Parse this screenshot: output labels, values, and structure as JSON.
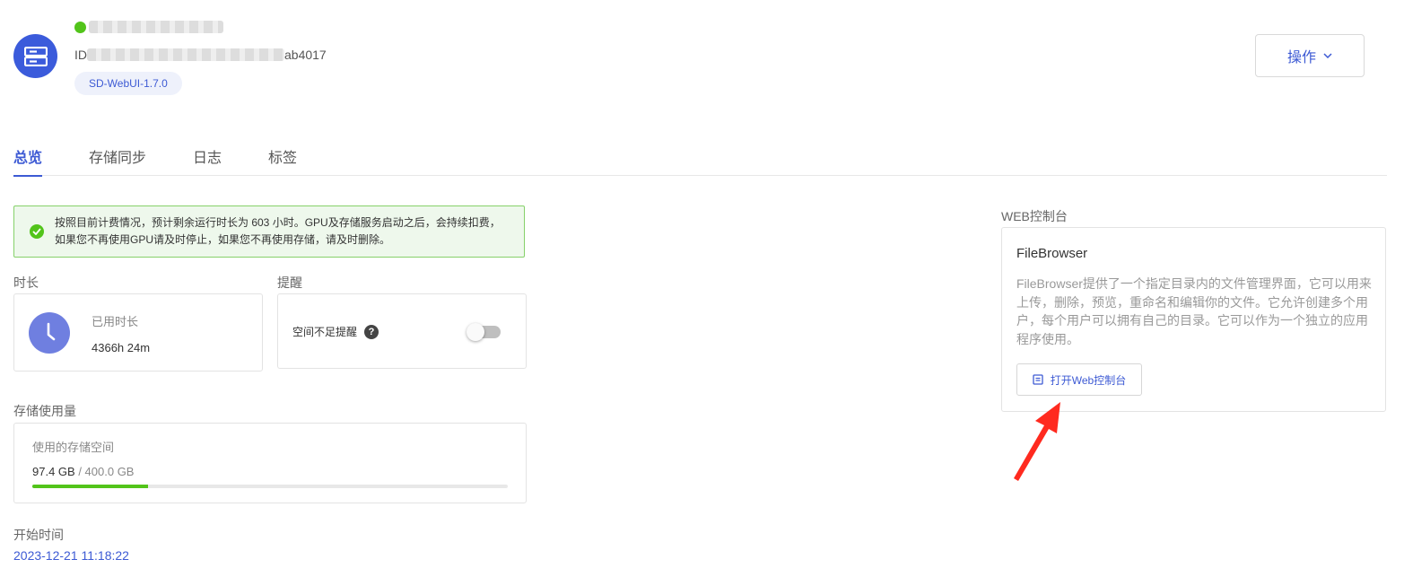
{
  "header": {
    "id_prefix": "ID",
    "id_suffix": "ab4017",
    "version_tag": "SD-WebUI-1.7.0",
    "action_button_label": "操作"
  },
  "tabs": [
    {
      "label": "总览",
      "active": true
    },
    {
      "label": "存储同步",
      "active": false
    },
    {
      "label": "日志",
      "active": false
    },
    {
      "label": "标签",
      "active": false
    }
  ],
  "alert": {
    "line1": "按照目前计费情况，预计剩余运行时长为 603 小时。GPU及存储服务启动之后，会持续扣费，",
    "line2": "如果您不再使用GPU请及时停止，如果您不再使用存储，请及时删除。"
  },
  "duration": {
    "section_title": "时长",
    "label": "已用时长",
    "value": "4366h 24m"
  },
  "reminder": {
    "section_title": "提醒",
    "label": "空间不足提醒",
    "enabled": false
  },
  "storage": {
    "section_title": "存储使用量",
    "label": "使用的存储空间",
    "used": "97.4 GB",
    "separator": " / ",
    "total": "400.0 GB",
    "used_fraction": 0.2435
  },
  "start": {
    "section_title": "开始时间",
    "value": "2023-12-21 11:18:22"
  },
  "web_console": {
    "section_title": "WEB控制台",
    "card_title": "FileBrowser",
    "description": "FileBrowser提供了一个指定目录内的文件管理界面，它可以用来上传，删除，预览，重命名和编辑你的文件。它允许创建多个用户，每个用户可以拥有自己的目录。它可以作为一个独立的应用程序使用。",
    "button_label": "打开Web控制台"
  },
  "colors": {
    "accent": "#3d5ad4",
    "success": "#52c41a",
    "arrow": "#ff2a1f"
  },
  "icons": {
    "app": "server-icon",
    "status": "status-dot",
    "clock": "clock-icon",
    "help": "question-icon",
    "alert": "check-circle-icon",
    "button": "document-icon",
    "dropdown": "chevron-down-icon"
  }
}
